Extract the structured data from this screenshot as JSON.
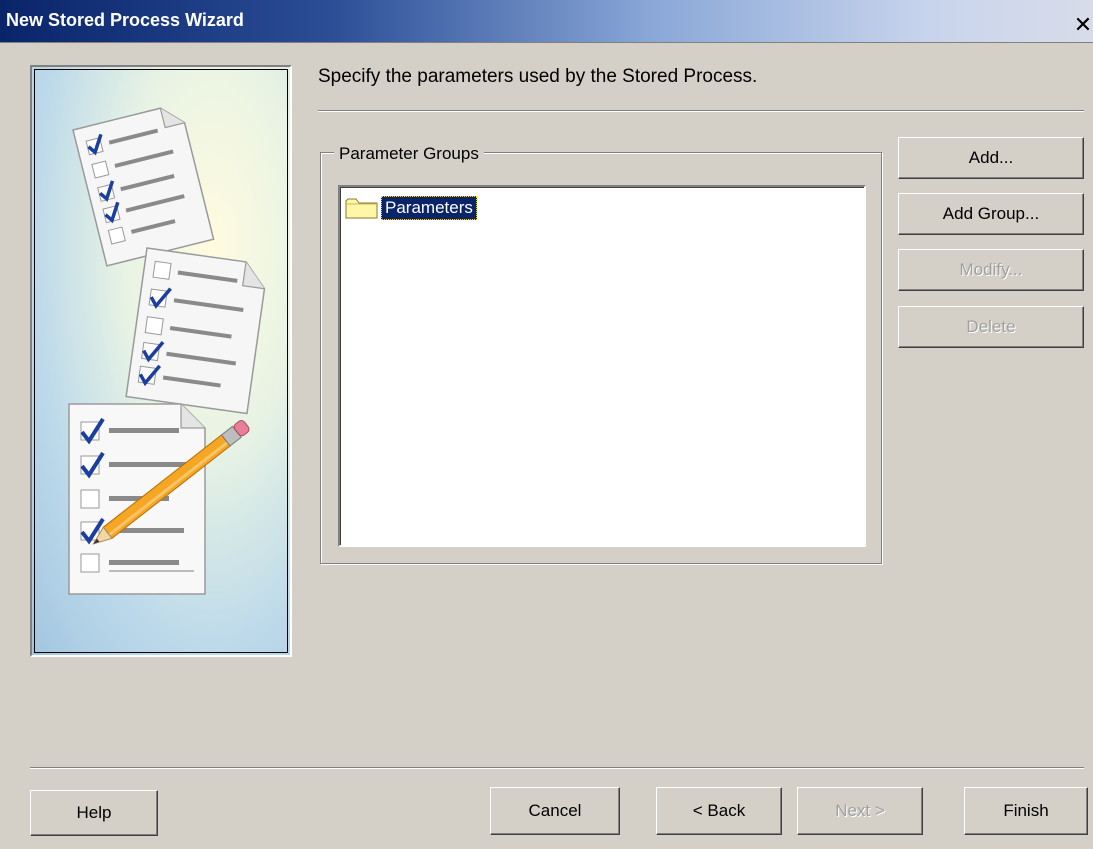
{
  "window": {
    "title": "New Stored Process Wizard",
    "close_glyph": "✕"
  },
  "page": {
    "instruction": "Specify the parameters used by the Stored Process."
  },
  "parameter_groups": {
    "legend": "Parameter Groups",
    "tree": [
      {
        "label": "Parameters",
        "icon": "folder-icon",
        "selected": true
      }
    ]
  },
  "side_buttons": {
    "add": "Add...",
    "add_group": "Add Group...",
    "modify": "Modify...",
    "delete": "Delete"
  },
  "footer_buttons": {
    "help": "Help",
    "cancel": "Cancel",
    "back": "< Back",
    "next": "Next >",
    "finish": "Finish"
  },
  "colors": {
    "selection_bg": "#0a246a",
    "dialog_bg": "#d4d0c8",
    "disabled_text": "#a0a0a0"
  }
}
